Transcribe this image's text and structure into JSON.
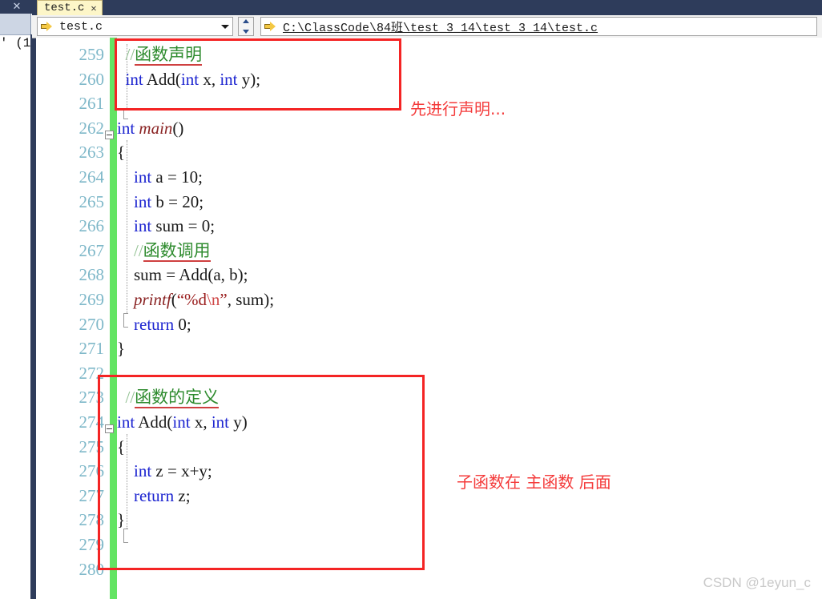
{
  "window": {
    "left_panel": {
      "close_icon": "✕",
      "fragment_text": "' (1"
    }
  },
  "tabs": [
    {
      "label": "test.c",
      "close": "✕",
      "active": true
    }
  ],
  "navbar": {
    "file_selector": {
      "icon": "yellow-arrow-icon",
      "value": "test.c",
      "caret": "chevron-down-icon"
    },
    "path": {
      "icon": "yellow-arrow-icon",
      "value": "C:\\ClassCode\\84班\\test_3_14\\test_3_14\\test.c"
    }
  },
  "editor": {
    "first_line_number": 259,
    "lines": [
      {
        "num": 259,
        "segments": [
          {
            "t": "  ",
            "c": "plain"
          },
          {
            "t": "//",
            "c": "cmt"
          },
          {
            "t": "函数声明",
            "c": "cmt-cn"
          }
        ]
      },
      {
        "num": 260,
        "segments": [
          {
            "t": "  ",
            "c": "plain"
          },
          {
            "t": "int",
            "c": "kw"
          },
          {
            "t": " Add(",
            "c": "plain"
          },
          {
            "t": "int",
            "c": "kw"
          },
          {
            "t": " x, ",
            "c": "plain"
          },
          {
            "t": "int",
            "c": "kw"
          },
          {
            "t": " y);",
            "c": "plain"
          }
        ]
      },
      {
        "num": 261,
        "segments": []
      },
      {
        "num": 262,
        "segments": [
          {
            "t": "int",
            "c": "kw"
          },
          {
            "t": " ",
            "c": "plain"
          },
          {
            "t": "main",
            "c": "fn"
          },
          {
            "t": "()",
            "c": "plain"
          }
        ]
      },
      {
        "num": 263,
        "segments": [
          {
            "t": "{",
            "c": "plain"
          }
        ]
      },
      {
        "num": 264,
        "segments": [
          {
            "t": "    ",
            "c": "plain"
          },
          {
            "t": "int",
            "c": "kw"
          },
          {
            "t": " a = ",
            "c": "plain"
          },
          {
            "t": "10",
            "c": "num"
          },
          {
            "t": ";",
            "c": "plain"
          }
        ]
      },
      {
        "num": 265,
        "segments": [
          {
            "t": "    ",
            "c": "plain"
          },
          {
            "t": "int",
            "c": "kw"
          },
          {
            "t": " b = ",
            "c": "plain"
          },
          {
            "t": "20",
            "c": "num"
          },
          {
            "t": ";",
            "c": "plain"
          }
        ]
      },
      {
        "num": 266,
        "segments": [
          {
            "t": "    ",
            "c": "plain"
          },
          {
            "t": "int",
            "c": "kw"
          },
          {
            "t": " sum = ",
            "c": "plain"
          },
          {
            "t": "0",
            "c": "num"
          },
          {
            "t": ";",
            "c": "plain"
          }
        ]
      },
      {
        "num": 267,
        "segments": [
          {
            "t": "    ",
            "c": "plain"
          },
          {
            "t": "//",
            "c": "cmt"
          },
          {
            "t": "函数调用",
            "c": "cmt-cn"
          }
        ]
      },
      {
        "num": 268,
        "segments": [
          {
            "t": "    sum = Add(a, b);",
            "c": "plain"
          }
        ]
      },
      {
        "num": 269,
        "segments": [
          {
            "t": "    ",
            "c": "plain"
          },
          {
            "t": "printf",
            "c": "fn"
          },
          {
            "t": "(",
            "c": "plain"
          },
          {
            "t": "“%d",
            "c": "str"
          },
          {
            "t": "\\n",
            "c": "esc"
          },
          {
            "t": "”",
            "c": "str"
          },
          {
            "t": ", sum);",
            "c": "plain"
          }
        ]
      },
      {
        "num": 270,
        "segments": [
          {
            "t": "    ",
            "c": "plain"
          },
          {
            "t": "return",
            "c": "kw"
          },
          {
            "t": " ",
            "c": "plain"
          },
          {
            "t": "0",
            "c": "num"
          },
          {
            "t": ";",
            "c": "plain"
          }
        ]
      },
      {
        "num": 271,
        "segments": [
          {
            "t": "}",
            "c": "plain"
          }
        ]
      },
      {
        "num": 272,
        "segments": []
      },
      {
        "num": 273,
        "segments": [
          {
            "t": "  ",
            "c": "plain"
          },
          {
            "t": "//",
            "c": "cmt"
          },
          {
            "t": "函数的定义",
            "c": "cmt-cn"
          }
        ]
      },
      {
        "num": 274,
        "segments": [
          {
            "t": "int",
            "c": "kw"
          },
          {
            "t": " Add(",
            "c": "plain"
          },
          {
            "t": "int",
            "c": "kw"
          },
          {
            "t": " x, ",
            "c": "plain"
          },
          {
            "t": "int",
            "c": "kw"
          },
          {
            "t": " y)",
            "c": "plain"
          }
        ]
      },
      {
        "num": 275,
        "segments": [
          {
            "t": "{",
            "c": "plain"
          }
        ]
      },
      {
        "num": 276,
        "segments": [
          {
            "t": "    ",
            "c": "plain"
          },
          {
            "t": "int",
            "c": "kw"
          },
          {
            "t": " z = x+y;",
            "c": "plain"
          }
        ]
      },
      {
        "num": 277,
        "segments": [
          {
            "t": "    ",
            "c": "plain"
          },
          {
            "t": "return",
            "c": "kw"
          },
          {
            "t": " z;",
            "c": "plain"
          }
        ]
      },
      {
        "num": 278,
        "segments": [
          {
            "t": "}",
            "c": "plain"
          }
        ]
      },
      {
        "num": 279,
        "segments": []
      },
      {
        "num": 280,
        "segments": []
      }
    ]
  },
  "annotations": [
    {
      "id": "declaration-note",
      "text": "先进行声明..."
    },
    {
      "id": "definition-note",
      "text": "子函数在 主函数 后面"
    }
  ],
  "watermark": "CSDN @1eyun_c",
  "colors": {
    "annotation_red": "#f42424",
    "change_bar_green": "#63e463",
    "keyword_blue": "#1c24d0",
    "comment_green": "#2e8b2e",
    "string_red": "#9b2020",
    "line_number": "#7fb8c9",
    "tab_yellow": "#fdf6c8",
    "chrome_navy": "#2e3c5b"
  }
}
